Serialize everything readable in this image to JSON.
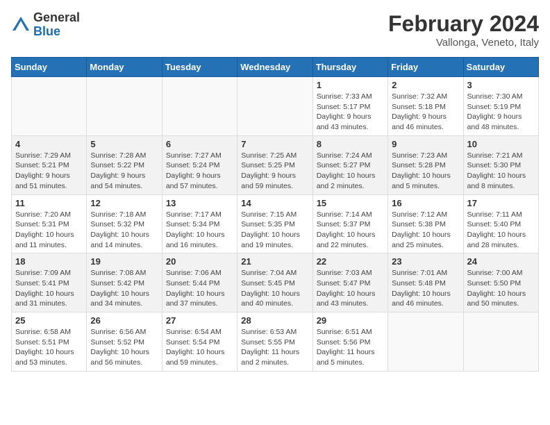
{
  "header": {
    "logo": {
      "general": "General",
      "blue": "Blue"
    },
    "month_title": "February 2024",
    "subtitle": "Vallonga, Veneto, Italy"
  },
  "weekdays": [
    "Sunday",
    "Monday",
    "Tuesday",
    "Wednesday",
    "Thursday",
    "Friday",
    "Saturday"
  ],
  "weeks": [
    [
      {
        "day": "",
        "info": ""
      },
      {
        "day": "",
        "info": ""
      },
      {
        "day": "",
        "info": ""
      },
      {
        "day": "",
        "info": ""
      },
      {
        "day": "1",
        "info": "Sunrise: 7:33 AM\nSunset: 5:17 PM\nDaylight: 9 hours\nand 43 minutes."
      },
      {
        "day": "2",
        "info": "Sunrise: 7:32 AM\nSunset: 5:18 PM\nDaylight: 9 hours\nand 46 minutes."
      },
      {
        "day": "3",
        "info": "Sunrise: 7:30 AM\nSunset: 5:19 PM\nDaylight: 9 hours\nand 48 minutes."
      }
    ],
    [
      {
        "day": "4",
        "info": "Sunrise: 7:29 AM\nSunset: 5:21 PM\nDaylight: 9 hours\nand 51 minutes."
      },
      {
        "day": "5",
        "info": "Sunrise: 7:28 AM\nSunset: 5:22 PM\nDaylight: 9 hours\nand 54 minutes."
      },
      {
        "day": "6",
        "info": "Sunrise: 7:27 AM\nSunset: 5:24 PM\nDaylight: 9 hours\nand 57 minutes."
      },
      {
        "day": "7",
        "info": "Sunrise: 7:25 AM\nSunset: 5:25 PM\nDaylight: 9 hours\nand 59 minutes."
      },
      {
        "day": "8",
        "info": "Sunrise: 7:24 AM\nSunset: 5:27 PM\nDaylight: 10 hours\nand 2 minutes."
      },
      {
        "day": "9",
        "info": "Sunrise: 7:23 AM\nSunset: 5:28 PM\nDaylight: 10 hours\nand 5 minutes."
      },
      {
        "day": "10",
        "info": "Sunrise: 7:21 AM\nSunset: 5:30 PM\nDaylight: 10 hours\nand 8 minutes."
      }
    ],
    [
      {
        "day": "11",
        "info": "Sunrise: 7:20 AM\nSunset: 5:31 PM\nDaylight: 10 hours\nand 11 minutes."
      },
      {
        "day": "12",
        "info": "Sunrise: 7:18 AM\nSunset: 5:32 PM\nDaylight: 10 hours\nand 14 minutes."
      },
      {
        "day": "13",
        "info": "Sunrise: 7:17 AM\nSunset: 5:34 PM\nDaylight: 10 hours\nand 16 minutes."
      },
      {
        "day": "14",
        "info": "Sunrise: 7:15 AM\nSunset: 5:35 PM\nDaylight: 10 hours\nand 19 minutes."
      },
      {
        "day": "15",
        "info": "Sunrise: 7:14 AM\nSunset: 5:37 PM\nDaylight: 10 hours\nand 22 minutes."
      },
      {
        "day": "16",
        "info": "Sunrise: 7:12 AM\nSunset: 5:38 PM\nDaylight: 10 hours\nand 25 minutes."
      },
      {
        "day": "17",
        "info": "Sunrise: 7:11 AM\nSunset: 5:40 PM\nDaylight: 10 hours\nand 28 minutes."
      }
    ],
    [
      {
        "day": "18",
        "info": "Sunrise: 7:09 AM\nSunset: 5:41 PM\nDaylight: 10 hours\nand 31 minutes."
      },
      {
        "day": "19",
        "info": "Sunrise: 7:08 AM\nSunset: 5:42 PM\nDaylight: 10 hours\nand 34 minutes."
      },
      {
        "day": "20",
        "info": "Sunrise: 7:06 AM\nSunset: 5:44 PM\nDaylight: 10 hours\nand 37 minutes."
      },
      {
        "day": "21",
        "info": "Sunrise: 7:04 AM\nSunset: 5:45 PM\nDaylight: 10 hours\nand 40 minutes."
      },
      {
        "day": "22",
        "info": "Sunrise: 7:03 AM\nSunset: 5:47 PM\nDaylight: 10 hours\nand 43 minutes."
      },
      {
        "day": "23",
        "info": "Sunrise: 7:01 AM\nSunset: 5:48 PM\nDaylight: 10 hours\nand 46 minutes."
      },
      {
        "day": "24",
        "info": "Sunrise: 7:00 AM\nSunset: 5:50 PM\nDaylight: 10 hours\nand 50 minutes."
      }
    ],
    [
      {
        "day": "25",
        "info": "Sunrise: 6:58 AM\nSunset: 5:51 PM\nDaylight: 10 hours\nand 53 minutes."
      },
      {
        "day": "26",
        "info": "Sunrise: 6:56 AM\nSunset: 5:52 PM\nDaylight: 10 hours\nand 56 minutes."
      },
      {
        "day": "27",
        "info": "Sunrise: 6:54 AM\nSunset: 5:54 PM\nDaylight: 10 hours\nand 59 minutes."
      },
      {
        "day": "28",
        "info": "Sunrise: 6:53 AM\nSunset: 5:55 PM\nDaylight: 11 hours\nand 2 minutes."
      },
      {
        "day": "29",
        "info": "Sunrise: 6:51 AM\nSunset: 5:56 PM\nDaylight: 11 hours\nand 5 minutes."
      },
      {
        "day": "",
        "info": ""
      },
      {
        "day": "",
        "info": ""
      }
    ]
  ]
}
